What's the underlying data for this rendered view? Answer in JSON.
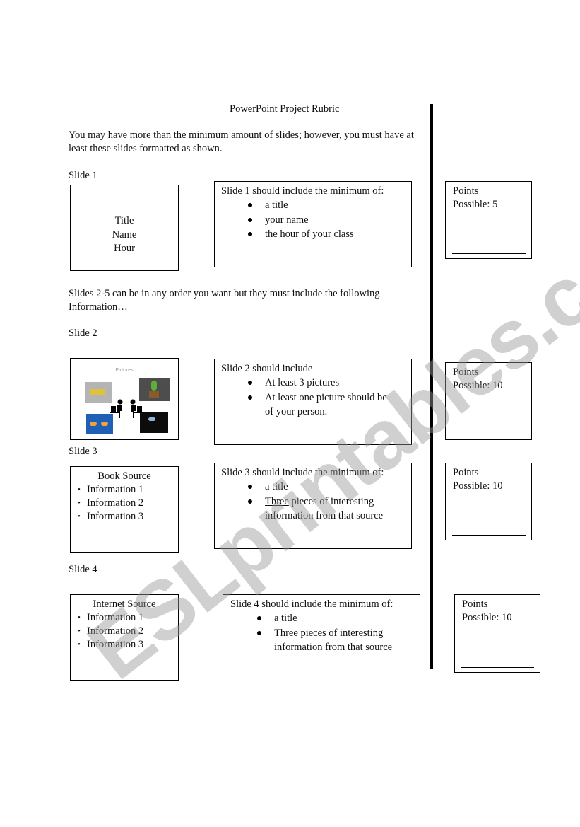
{
  "document": {
    "title": "PowerPoint Project Rubric",
    "intro": "You may have more than the minimum amount of slides; however, you must have at least these slides formatted as shown.",
    "middle_note": "Slides 2-5 can be in any order you want but they must include the following Information…",
    "watermark": "ESLprintables.com"
  },
  "slides": [
    {
      "label": "Slide 1",
      "example_lines": [
        "Title",
        "Name",
        "Hour"
      ],
      "requirements_heading": "Slide 1 should include the minimum of:",
      "requirements": [
        "a title",
        "your name",
        "the hour of your class"
      ],
      "points_label": "Points",
      "points_possible": "Possible: 5"
    },
    {
      "label": "Slide 2",
      "example_title": "Pictures",
      "requirements_heading": "Slide 2 should include",
      "requirements": [
        "At least 3 pictures",
        "At least one picture should be of your person."
      ],
      "points_label": "Points",
      "points_possible": "Possible: 10"
    },
    {
      "label": "Slide 3",
      "example_title": "Book Source",
      "example_items": [
        "Information 1",
        "Information 2",
        "Information 3"
      ],
      "requirements_heading": "Slide 3 should include the minimum of:",
      "requirements_first": "a title",
      "requirements_second_underlined": "Three",
      "requirements_second_rest": " pieces of interesting information from that source",
      "points_label": "Points",
      "points_possible": "Possible: 10"
    },
    {
      "label": "Slide 4",
      "example_title": "Internet Source",
      "example_items": [
        "Information 1",
        "Information 2",
        "Information 3"
      ],
      "requirements_heading": "Slide 4 should include the minimum of:",
      "requirements_first": "a title",
      "requirements_second_underlined": "Three",
      "requirements_second_rest": " pieces of interesting information from that source",
      "points_label": "Points",
      "points_possible": "Possible: 10"
    }
  ]
}
